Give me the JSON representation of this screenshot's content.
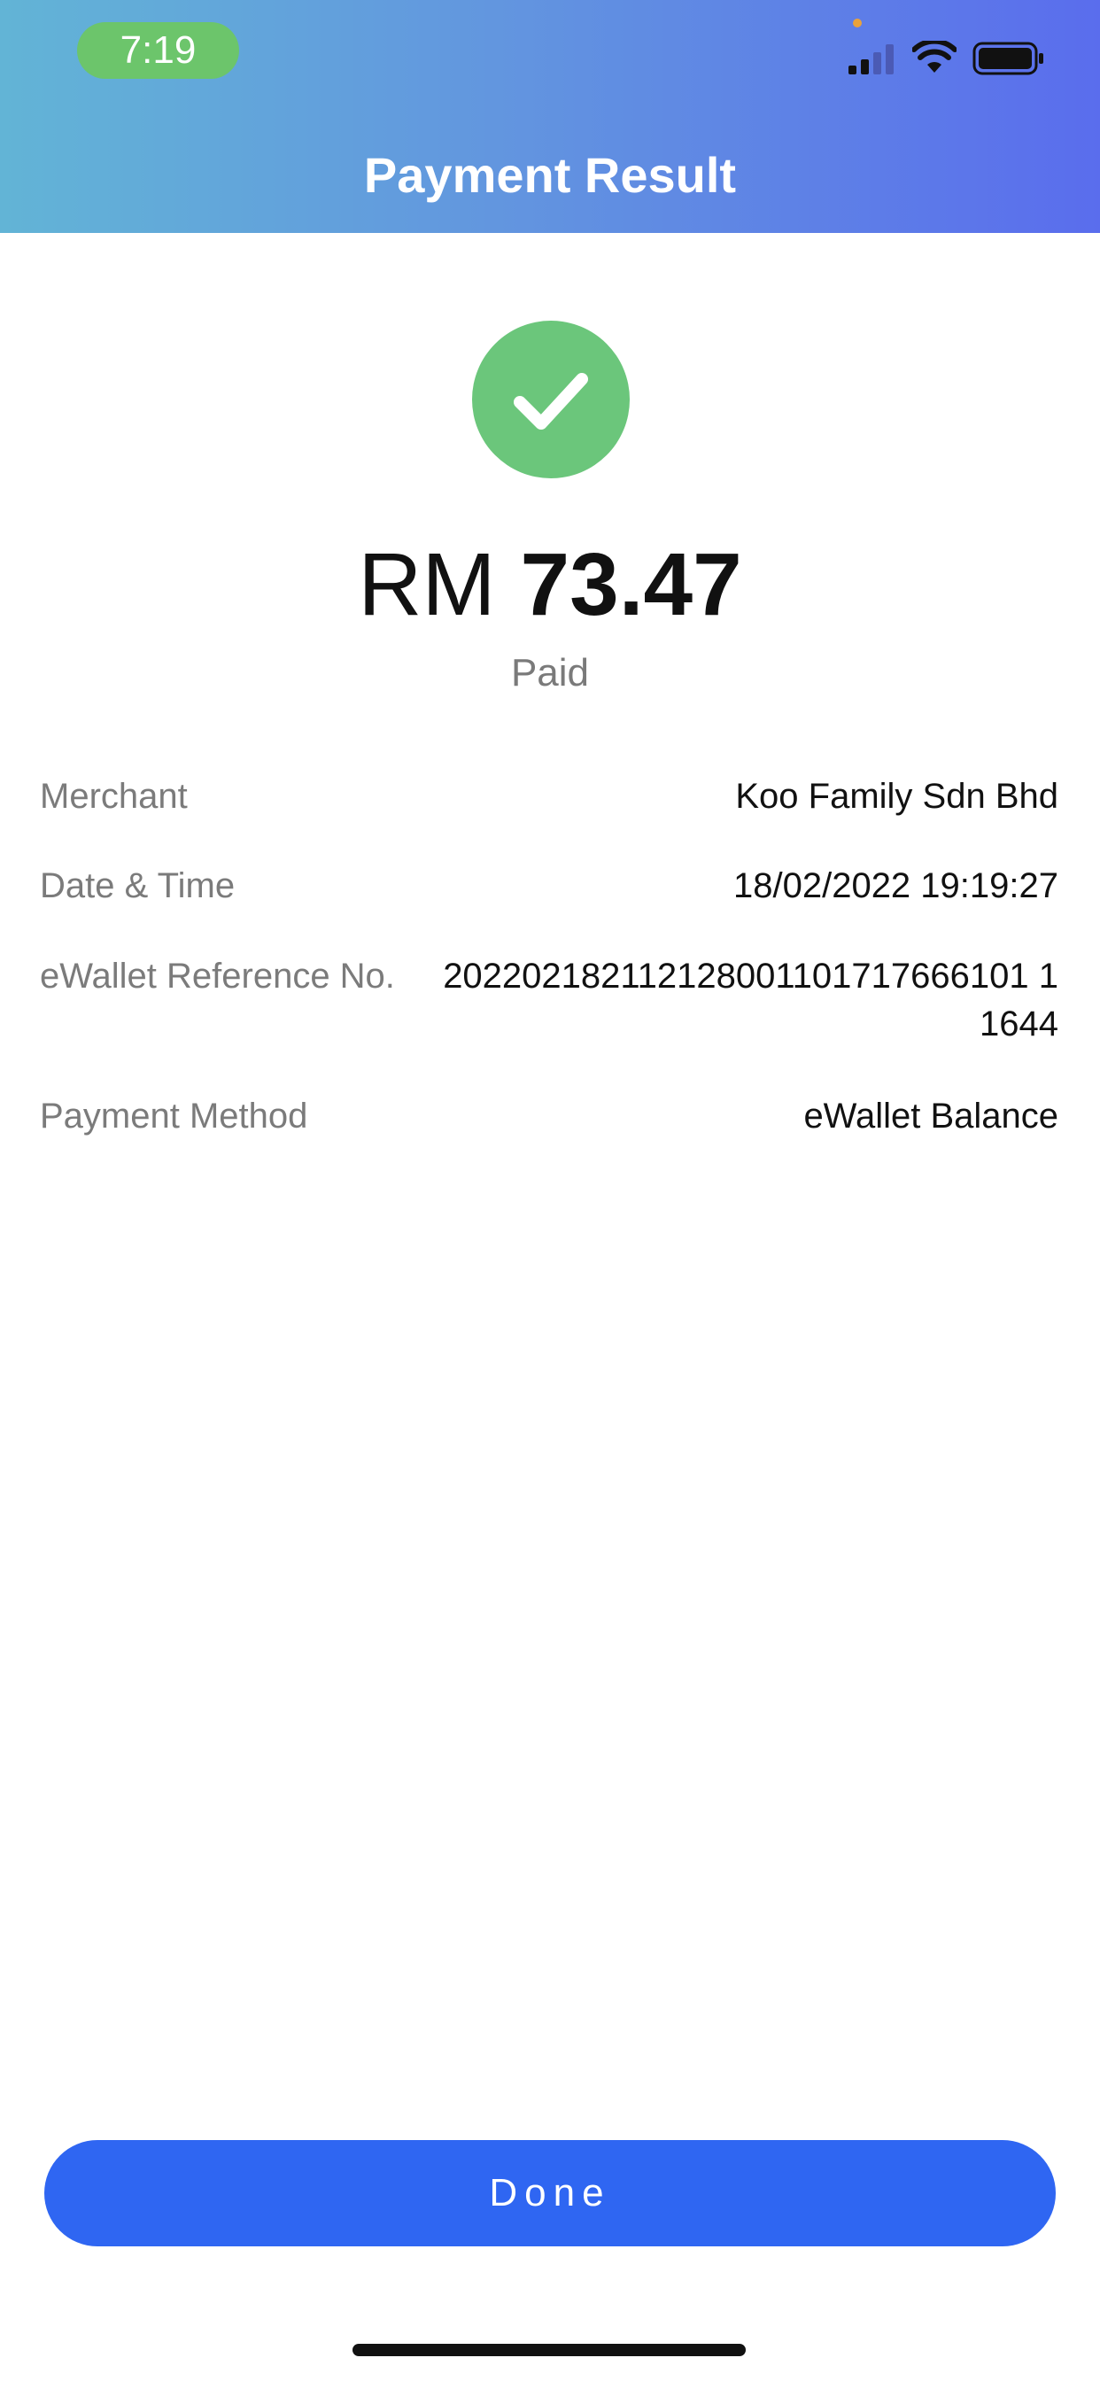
{
  "status_bar": {
    "time": "7:19",
    "signal_icon": "cellular-signal-icon",
    "wifi_icon": "wifi-icon",
    "battery_icon": "battery-icon"
  },
  "header": {
    "title": "Payment Result"
  },
  "result": {
    "icon": "check-icon",
    "currency": "RM",
    "amount": "73.47",
    "status": "Paid",
    "status_color": "#6bc67b"
  },
  "details": {
    "merchant_label": "Merchant",
    "merchant_value": "Koo Family Sdn Bhd",
    "datetime_label": "Date & Time",
    "datetime_value": "18/02/2022 19:19:27",
    "reference_label": "eWallet Reference No.",
    "reference_value": "202202182112128001101717666101 11644",
    "method_label": "Payment Method",
    "method_value": "eWallet Balance"
  },
  "actions": {
    "done_label": "Done",
    "done_color": "#2f66f2"
  },
  "theme": {
    "header_gradient_start": "#62b4d6",
    "header_gradient_end": "#5a6ded"
  }
}
